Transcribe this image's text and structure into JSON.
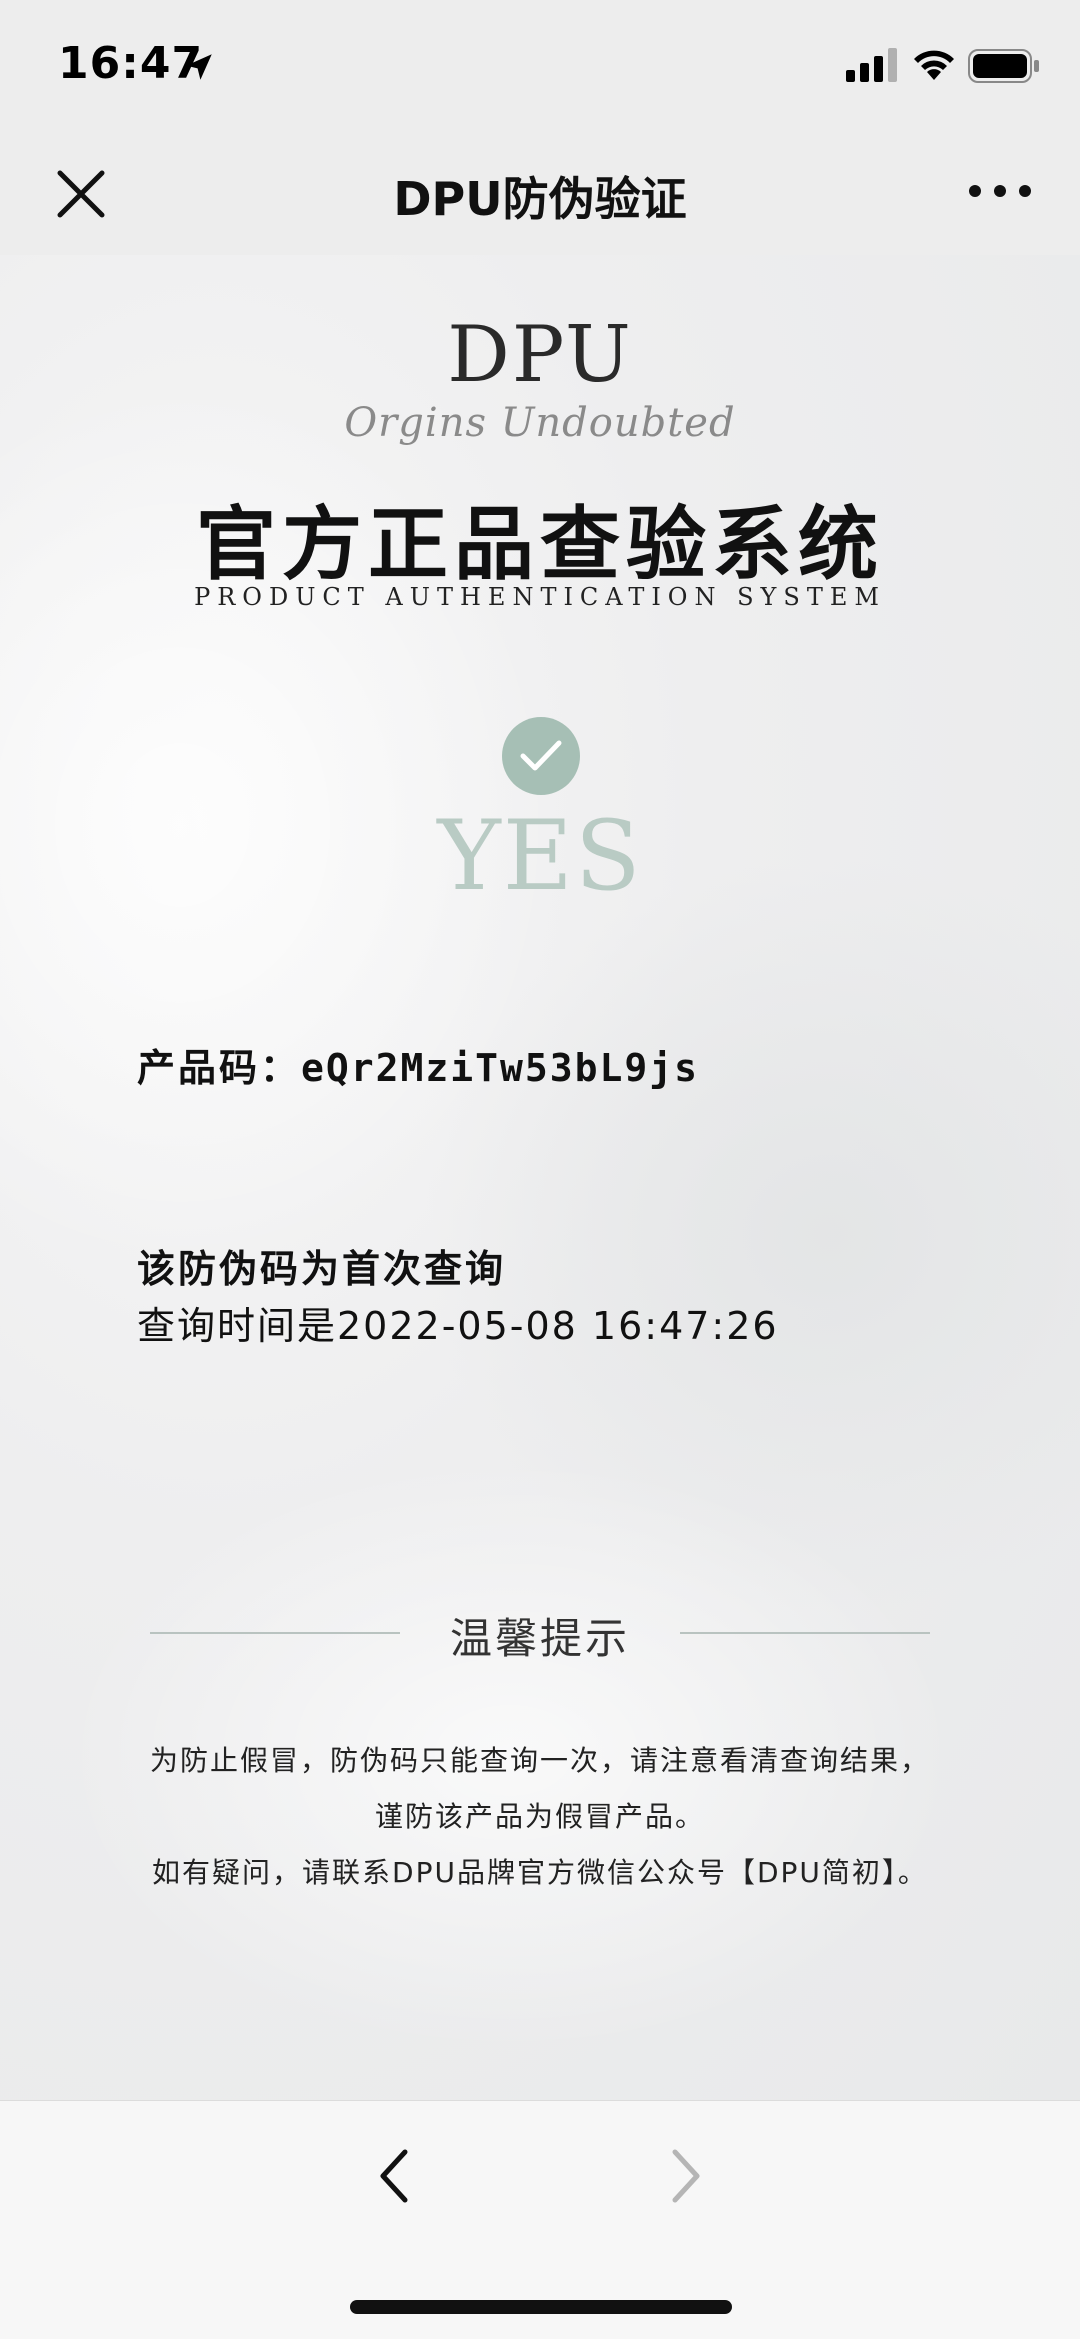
{
  "status_bar": {
    "time": "16:47",
    "icons": [
      "location-arrow-icon",
      "signal-icon",
      "wifi-icon",
      "battery-icon"
    ]
  },
  "nav": {
    "title": "DPU防伪验证",
    "close_icon": "close-icon",
    "more_icon": "more-icon"
  },
  "page": {
    "logo": "DPU",
    "logo_script": "Orgins Undoubted",
    "title": "官方正品查验系统",
    "subtitle": "PRODUCT AUTHENTICATION SYSTEM",
    "check_icon": "check-icon",
    "result": "YES",
    "product_code_label": "产品码：",
    "product_code": "eQr2MziTw53bL9js",
    "first_query": "该防伪码为首次查询",
    "query_time": "查询时间是2022-05-08 16:47:26",
    "tips_title": "温馨提示",
    "tips": [
      "为防止假冒，防伪码只能查询一次，请注意看清查询结果，",
      "谨防该产品为假冒产品。",
      "如有疑问，请联系DPU品牌官方微信公众号【DPU简初】。"
    ]
  },
  "toolbar": {
    "back_icon": "chevron-left-icon",
    "forward_icon": "chevron-right-icon"
  },
  "colors": {
    "accent_green": "#a6bfb5",
    "yes_text": "#b9cbc4",
    "background": "#ededed"
  }
}
